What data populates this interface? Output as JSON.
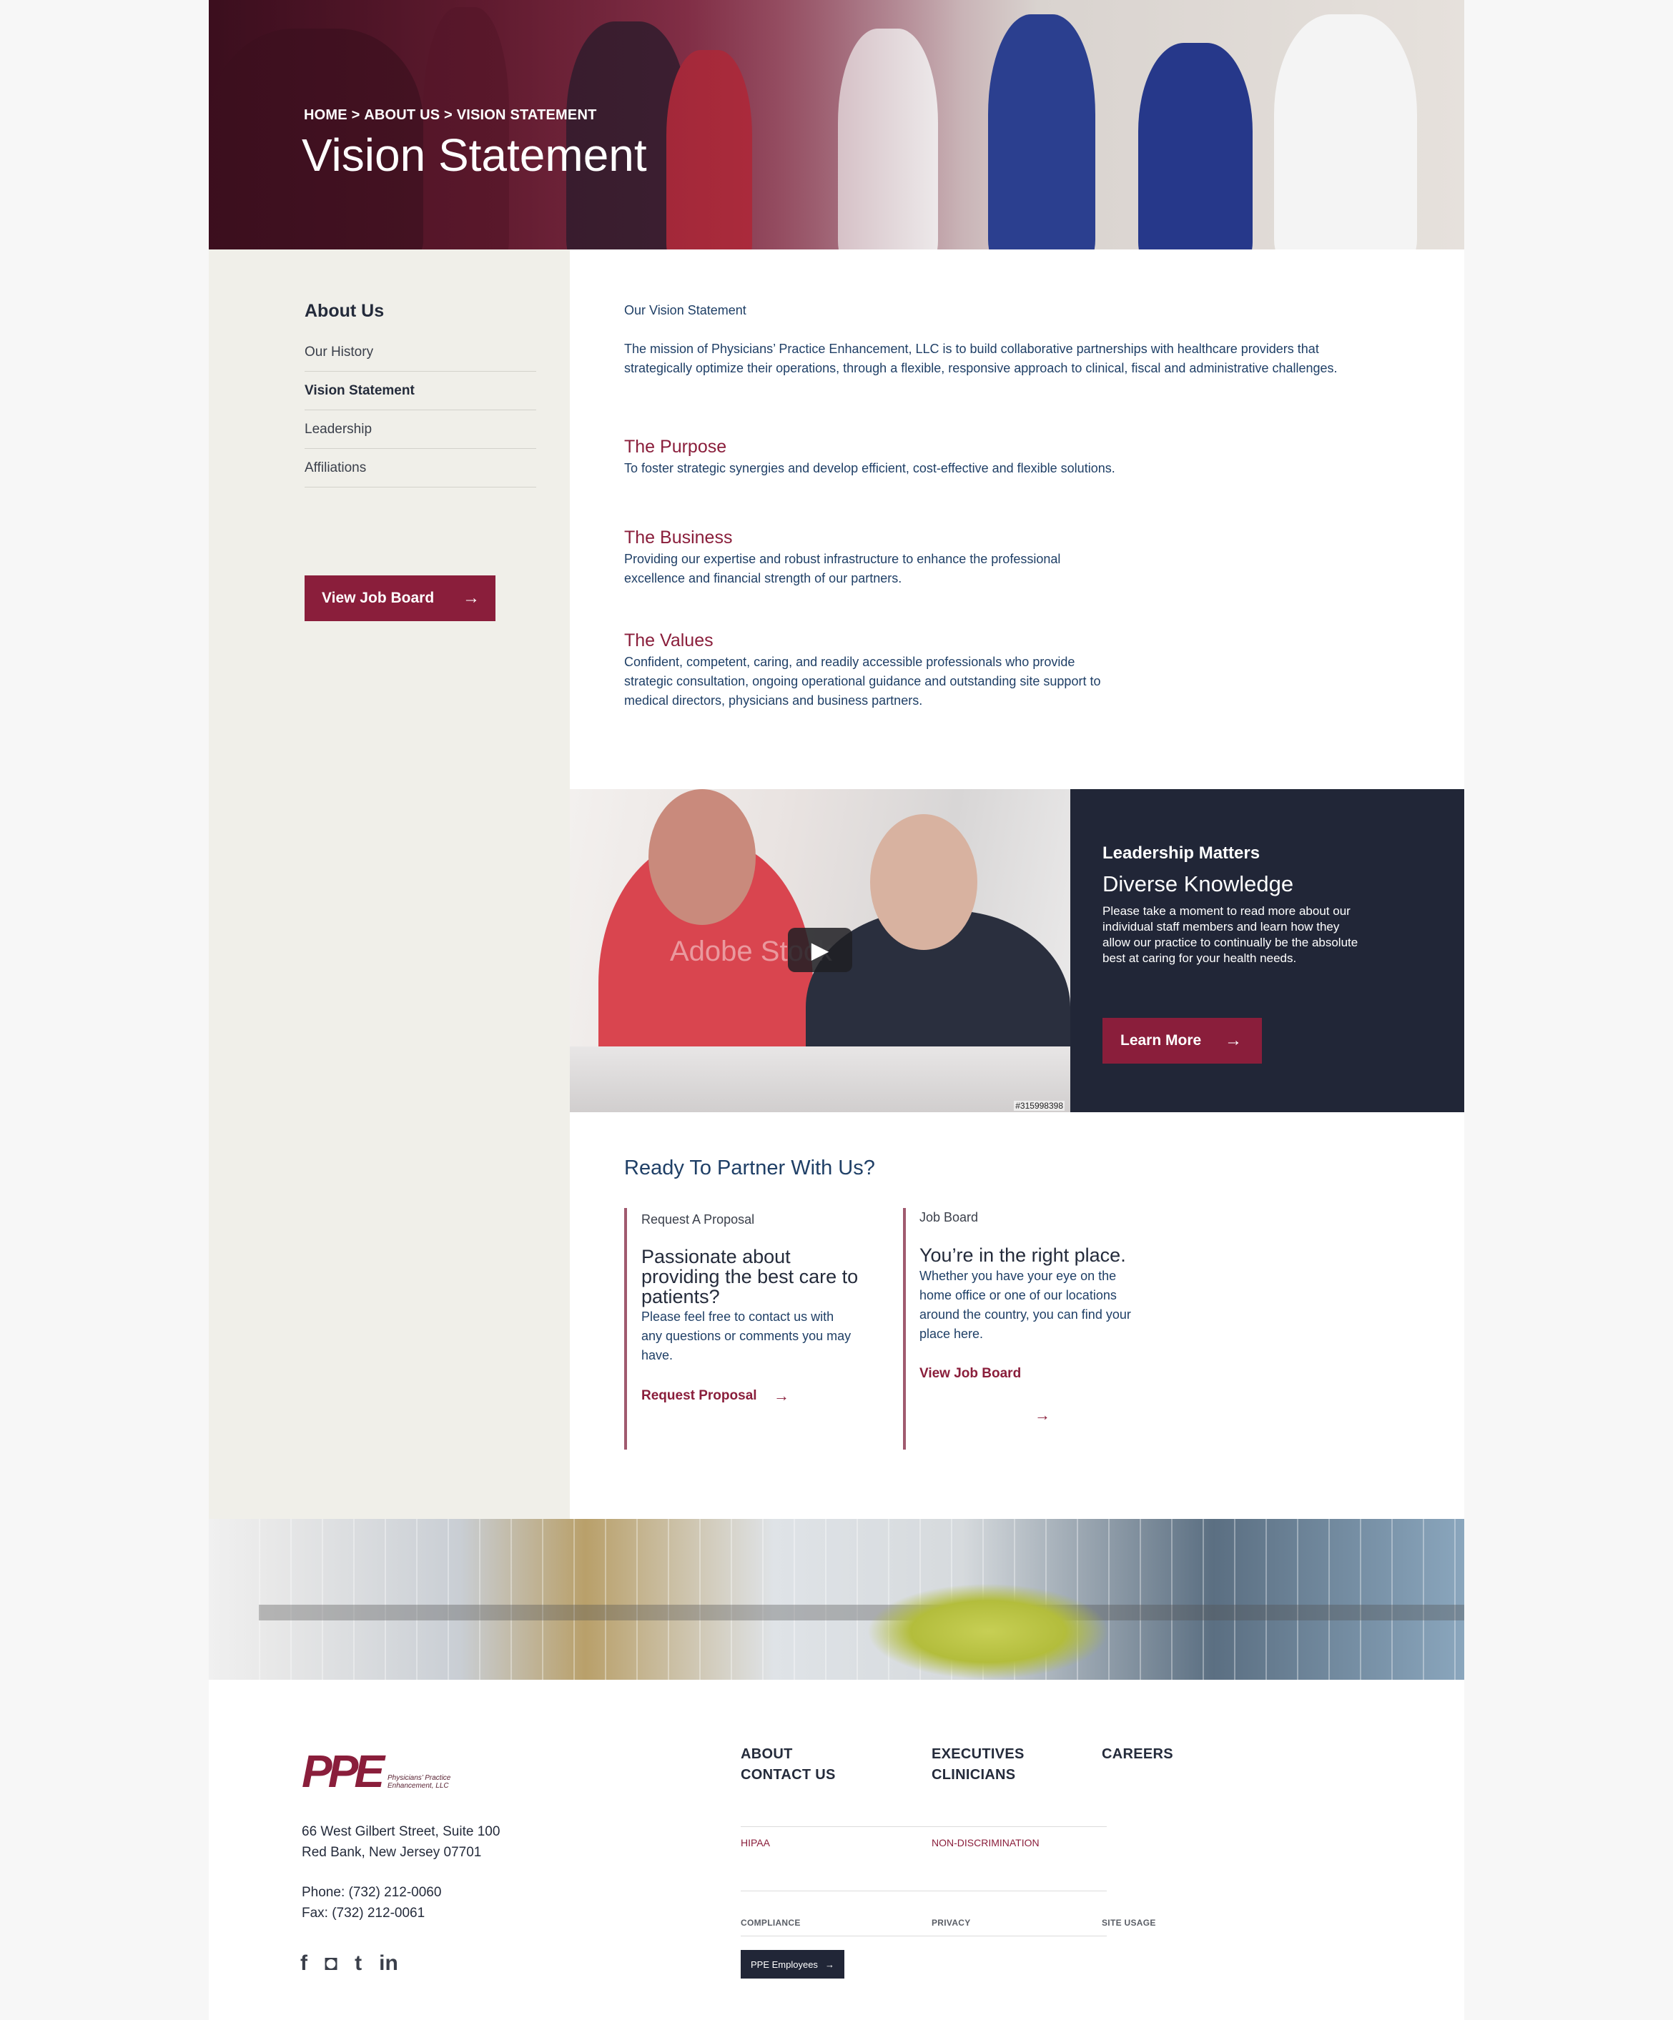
{
  "hero": {
    "breadcrumb": [
      "HOME",
      ">",
      "ABOUT US",
      ">",
      "VISION STATEMENT"
    ],
    "title": "Vision Statement"
  },
  "sidebar": {
    "heading": "About Us",
    "items": [
      {
        "label": "Our History"
      },
      {
        "label": "Vision Statement"
      },
      {
        "label": "Leadership"
      },
      {
        "label": "Affiliations"
      }
    ],
    "button_label": "View Job Board",
    "arrow_icon": "arrow-right-icon"
  },
  "main": {
    "intro_title": "Our Vision Statement",
    "intro_text": "The mission of Physicians’ Practice Enhancement, LLC is to build collaborative partnerships with healthcare providers that strategically optimize their operations, through a flexible, responsive approach to clinical, fiscal and administrative challenges.",
    "sections": [
      {
        "title": "The Purpose",
        "text": "To foster strategic synergies and develop efficient, cost-effective and flexible solutions."
      },
      {
        "title": "The Business",
        "text": "Providing our expertise and robust infrastructure to enhance the professional excellence and financial strength of our partners."
      },
      {
        "title": "The Values",
        "text": "Confident, competent, caring, and readily accessible professionals who provide strategic consultation, ongoing operational guidance and outstanding site support to medical directors, physicians and business partners."
      }
    ]
  },
  "video": {
    "id_label": "#315998398",
    "watermark": "Adobe Stock"
  },
  "leadership": {
    "kicker": "Leadership Matters",
    "title": "Diverse Knowledge",
    "text": "Please take a moment to read more about our individual staff members and learn how they allow our practice to continually be the absolute best at caring for your health needs.",
    "button_label": "Learn More"
  },
  "partner": {
    "title": "Ready To Partner With Us?",
    "columns": [
      {
        "label": "Request A Proposal",
        "heading": "Passionate about providing the best care to patients?",
        "text": "Please feel free to contact us with any questions or comments you may have.",
        "link": "Request Proposal"
      },
      {
        "label": "Job Board",
        "heading": "You’re in the right place.",
        "text": "Whether you have your eye on the home office or one of our locations around the country, you can find your place here.",
        "link": "View Job Board"
      }
    ]
  },
  "footer": {
    "logo_mark": "PPE",
    "logo_text": "Physicians’ Practice Enhancement, LLC",
    "address_line1": "66 West Gilbert Street, Suite 100",
    "address_line2": "Red Bank, New Jersey 07701",
    "phone": "Phone: (732) 212-0060",
    "fax": "Fax: (732) 212-0061",
    "social": [
      "f",
      "◘",
      "t",
      "in"
    ],
    "nav": {
      "about": "ABOUT",
      "contact": "CONTACT US",
      "executives": "EXECUTIVES",
      "clinicians": "CLINICIANS",
      "careers": "CAREERS"
    },
    "legal": {
      "hipaa": "HIPAA",
      "nondiscrimination": "NON-DISCRIMINATION"
    },
    "utility": {
      "compliance": "COMPLIANCE",
      "privacy": "PRIVACY",
      "site_usage": "SITE USAGE"
    },
    "employees_button": "PPE Employees"
  },
  "colors": {
    "brand": "#8a1e3b",
    "navy": "#212637",
    "text": "#1f3f66",
    "sidebar_bg": "#f0efe9"
  }
}
